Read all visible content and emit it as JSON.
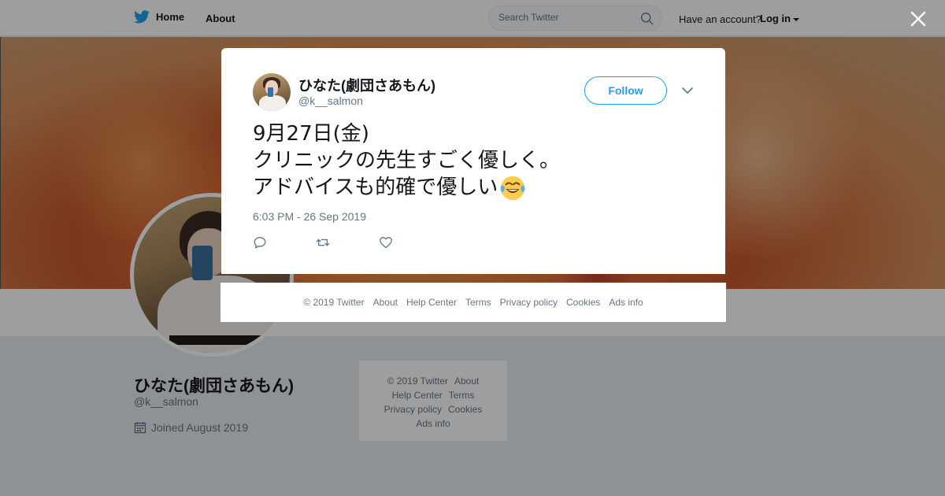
{
  "topbar": {
    "home_label": "Home",
    "about_label": "About",
    "search_placeholder": "Search Twitter",
    "have_account": "Have an account?",
    "login_label": "Log in"
  },
  "profile": {
    "name": "ひなた(劇団さあもん)",
    "handle": "@k__salmon",
    "joined": "Joined August 2019"
  },
  "side_footer": {
    "row1": [
      "© 2019 Twitter",
      "About"
    ],
    "row2": [
      "Help Center",
      "Terms"
    ],
    "row3": [
      "Privacy policy",
      "Cookies"
    ],
    "row4": [
      "Ads info"
    ]
  },
  "tweet": {
    "author_name": "ひなた(劇団さあもん)",
    "author_handle": "@k__salmon",
    "follow_label": "Follow",
    "lines": [
      "9月27日(金)",
      "クリニックの先生すごく優しく。",
      "アドバイスも的確で優しい"
    ],
    "emoji": "face-with-tears-of-joy",
    "timestamp": "6:03 PM - 26 Sep 2019"
  },
  "modal_footer": {
    "links": [
      "© 2019 Twitter",
      "About",
      "Help Center",
      "Terms",
      "Privacy policy",
      "Cookies",
      "Ads info"
    ]
  },
  "icons": {
    "twitter_bird": "twitter-bird-icon",
    "search": "search-icon",
    "close": "close-icon",
    "caret": "chevron-down-icon",
    "reply": "reply-icon",
    "retweet": "retweet-icon",
    "like": "heart-icon",
    "calendar": "calendar-icon"
  },
  "colors": {
    "brand_blue": "#1da1f2",
    "secondary_text": "#657786",
    "primary_text": "#14171a"
  }
}
